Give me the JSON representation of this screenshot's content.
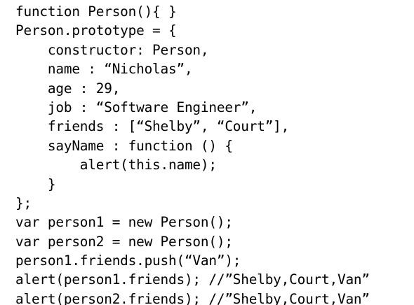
{
  "heading_fragment": "",
  "code": {
    "language": "JavaScript",
    "lines": [
      "function Person(){ }",
      "Person.prototype = {",
      "    constructor: Person,",
      "    name : “Nicholas”,",
      "    age : 29,",
      "    job : “Software Engineer”,",
      "    friends : [“Shelby”, “Court”],",
      "    sayName : function () {",
      "        alert(this.name);",
      "    }",
      "};",
      "var person1 = new Person();",
      "var person2 = new Person();",
      "person1.friends.push(“Van”);",
      "alert(person1.friends); //”Shelby,Court,Van”",
      "alert(person2.friends); //”Shelby,Court,Van”"
    ]
  },
  "colors": {
    "background": "#ffffff",
    "text": "#000000"
  }
}
